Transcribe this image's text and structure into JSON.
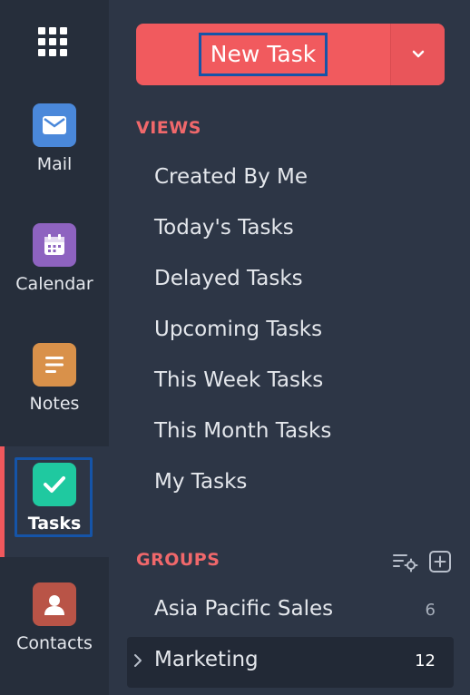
{
  "apps": [
    {
      "label": "Mail",
      "icon": "mail-icon",
      "color": "#4a88da"
    },
    {
      "label": "Calendar",
      "icon": "calendar-icon",
      "color": "#8e63c0"
    },
    {
      "label": "Notes",
      "icon": "notes-icon",
      "color": "#d9914a"
    },
    {
      "label": "Tasks",
      "icon": "tasks-icon",
      "color": "#1fc9a0",
      "active": true
    },
    {
      "label": "Contacts",
      "icon": "contacts-icon",
      "color": "#b95447"
    }
  ],
  "new_task": {
    "label": "New Task",
    "dropdown_icon": "chevron-down-icon"
  },
  "views": {
    "title": "VIEWS",
    "items": [
      "Created By Me",
      "Today's Tasks",
      "Delayed Tasks",
      "Upcoming Tasks",
      "This Week Tasks",
      "This Month Tasks",
      "My Tasks"
    ]
  },
  "groups": {
    "title": "GROUPS",
    "tools": [
      "group-settings-icon",
      "add-icon"
    ],
    "items": [
      {
        "name": "Asia Pacific Sales",
        "count": "6"
      },
      {
        "name": "Marketing",
        "count": "12",
        "selected": true
      }
    ]
  },
  "colors": {
    "accent": "#f15a5e",
    "focus_ring": "#1554a8",
    "rail": "#262e3b",
    "panel": "#2d3646"
  }
}
